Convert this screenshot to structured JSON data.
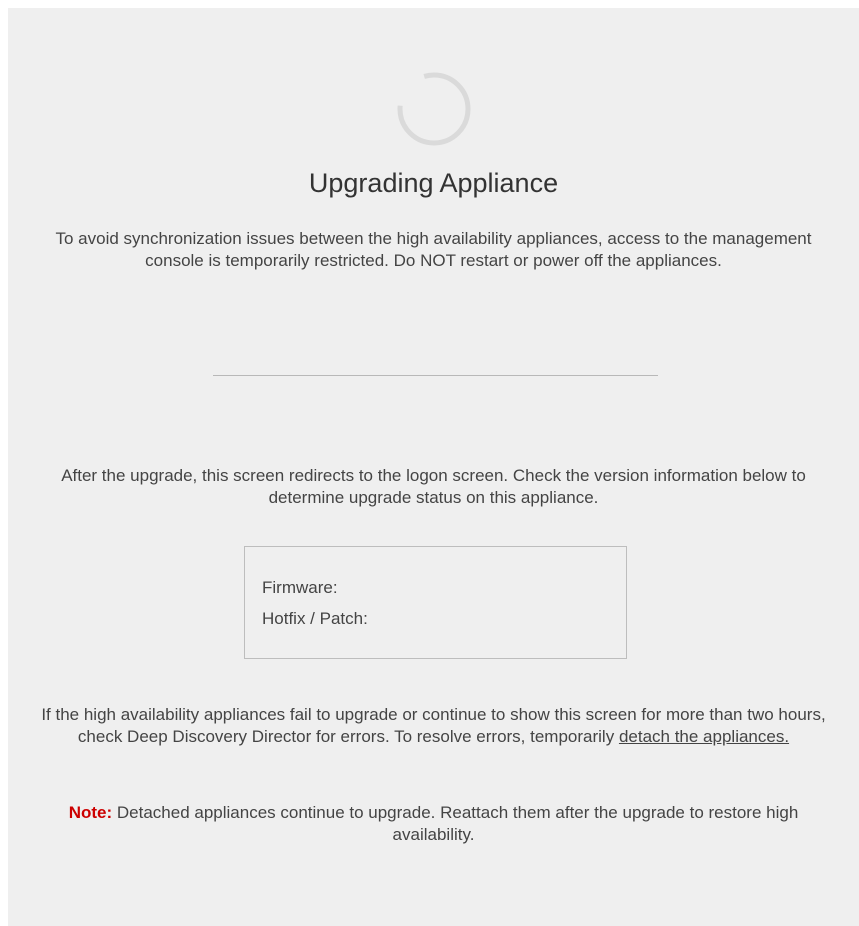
{
  "title": "Upgrading Appliance",
  "intro_text": "To avoid synchronization issues between the high availability appliances, access to the management console is temporarily restricted. Do NOT restart or power off the appliances.",
  "after_upgrade_text": "After the upgrade, this screen redirects to the logon screen. Check the version information below to determine upgrade status on this appliance.",
  "version_info": {
    "firmware_label": "Firmware:",
    "firmware_value": "",
    "hotfix_label": "Hotfix / Patch:",
    "hotfix_value": ""
  },
  "failure_text": "If the high availability appliances fail to upgrade or continue to show this screen for more than two hours, check Deep Discovery Director for errors. To resolve errors, temporarily ",
  "detach_link_label": "detach the appliances.",
  "note": {
    "label": "Note:",
    "text": " Detached appliances continue to upgrade. Reattach them after the upgrade to restore high availability."
  },
  "colors": {
    "background": "#efefef",
    "note_label": "#cc0000",
    "spinner": "#d9d9d9"
  },
  "icons": {
    "spinner": "loading-spinner-icon"
  }
}
